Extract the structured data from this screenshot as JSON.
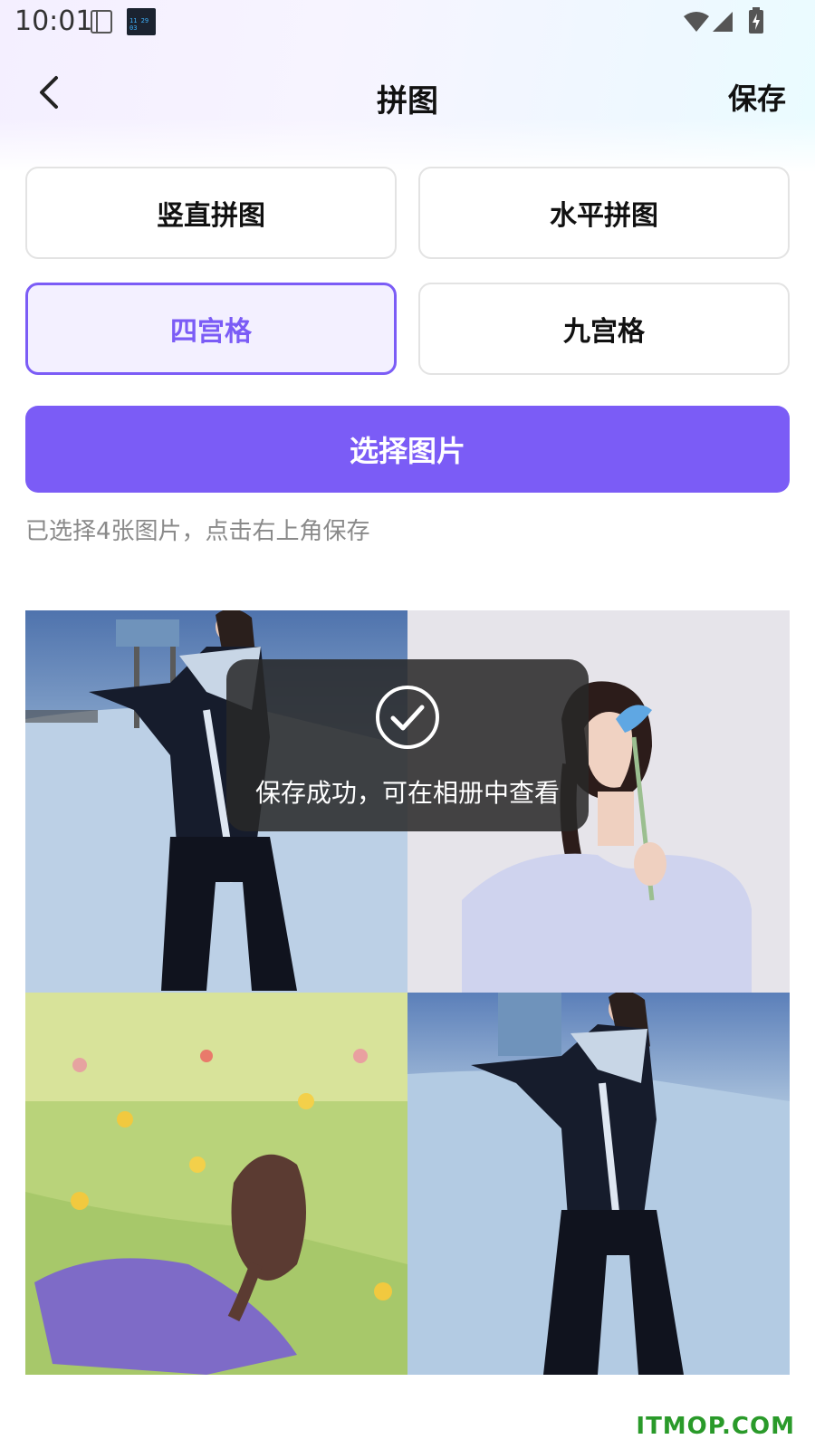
{
  "status_bar": {
    "time": "10:01",
    "clock_widget_text": "11 29 03",
    "icons": [
      "notebook-icon",
      "clock-widget-icon",
      "wifi-icon",
      "signal-icon",
      "battery-charging-icon"
    ]
  },
  "nav": {
    "title": "拼图",
    "save_label": "保存",
    "back_icon": "chevron-left-icon"
  },
  "layout_options": [
    {
      "label": "竖直拼图",
      "selected": false
    },
    {
      "label": "水平拼图",
      "selected": false
    },
    {
      "label": "四宫格",
      "selected": true
    },
    {
      "label": "九宫格",
      "selected": false
    }
  ],
  "select_button_label": "选择图片",
  "hint_text": "已选择4张图片，点击右上角保存",
  "grid": {
    "images": [
      "skier-in-black-jacket-photo",
      "woman-with-blue-flower-photo",
      "girl-in-flower-field-painting",
      "skier-in-black-jacket-photo"
    ]
  },
  "toast": {
    "icon": "check-circle-icon",
    "message": "保存成功，可在相册中查看"
  },
  "watermark": "ITMOP.COM",
  "colors": {
    "accent": "#7b5cf6",
    "selected_bg": "#f3f0ff",
    "hint": "#8a8a8a",
    "watermark": "#2a9a2a"
  }
}
